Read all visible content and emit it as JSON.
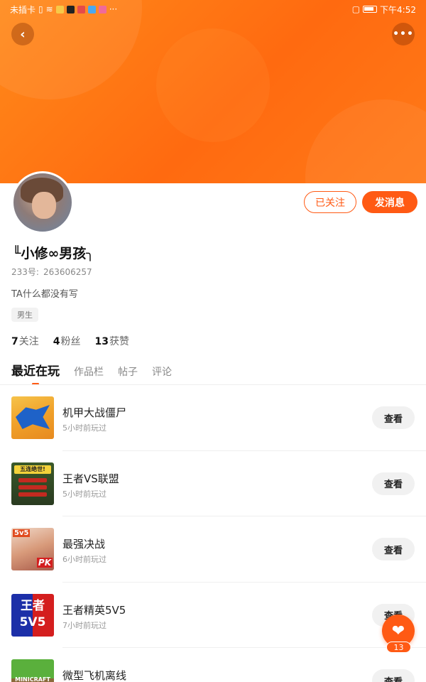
{
  "status_bar": {
    "carrier": "未插卡",
    "time": "下午4:52",
    "more": "···"
  },
  "colors": {
    "accent": "#ff5a14",
    "banner": "#ff7a18"
  },
  "header": {
    "back_icon": "back-arrow-icon",
    "more_icon": "more-dots-icon"
  },
  "profile": {
    "nickname": "╙小修∞男孩╮",
    "uid_label": "233号:",
    "uid": "263606257",
    "bio": "TA什么都没有写",
    "gender": "男生",
    "followed_label": "已关注",
    "message_label": "发消息",
    "stats": {
      "following_count": "7",
      "following_label": "关注",
      "fans_count": "4",
      "fans_label": "粉丝",
      "likes_count": "13",
      "likes_label": "获赞"
    }
  },
  "tabs": [
    {
      "label": "最近在玩",
      "active": true
    },
    {
      "label": "作品栏",
      "active": false
    },
    {
      "label": "帖子",
      "active": false
    },
    {
      "label": "评论",
      "active": false
    }
  ],
  "games": [
    {
      "title": "机甲大战僵尸",
      "time": "5小时前玩过",
      "action": "查看"
    },
    {
      "title": "王者VS联盟",
      "time": "5小时前玩过",
      "action": "查看"
    },
    {
      "title": "最强决战",
      "time": "6小时前玩过",
      "action": "查看"
    },
    {
      "title": "王者精英5V5",
      "time": "7小时前玩过",
      "action": "查看"
    },
    {
      "title": "微型飞机离线",
      "time": "",
      "action": "查看"
    }
  ],
  "thumb_text": {
    "g2_banner": "五连绝世!",
    "g3_corner": "5v5",
    "g3_badge": "PK",
    "g4_line1": "王者",
    "g4_line2": "5V5",
    "g5_text": "MINICRAFT"
  },
  "fab": {
    "icon": "heart-icon",
    "count": "13"
  }
}
